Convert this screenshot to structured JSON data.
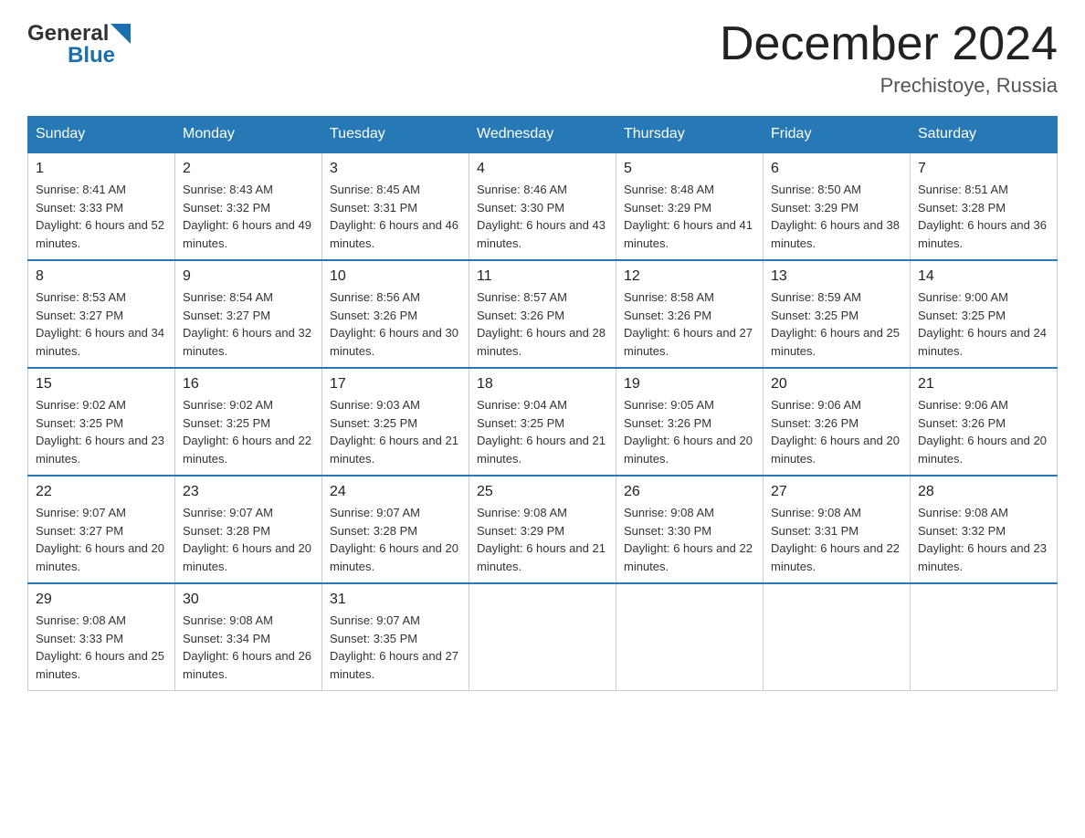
{
  "header": {
    "logo_general": "General",
    "logo_blue": "Blue",
    "month_title": "December 2024",
    "location": "Prechistoye, Russia"
  },
  "days_of_week": [
    "Sunday",
    "Monday",
    "Tuesday",
    "Wednesday",
    "Thursday",
    "Friday",
    "Saturday"
  ],
  "weeks": [
    [
      {
        "day": "1",
        "sunrise": "8:41 AM",
        "sunset": "3:33 PM",
        "daylight": "6 hours and 52 minutes."
      },
      {
        "day": "2",
        "sunrise": "8:43 AM",
        "sunset": "3:32 PM",
        "daylight": "6 hours and 49 minutes."
      },
      {
        "day": "3",
        "sunrise": "8:45 AM",
        "sunset": "3:31 PM",
        "daylight": "6 hours and 46 minutes."
      },
      {
        "day": "4",
        "sunrise": "8:46 AM",
        "sunset": "3:30 PM",
        "daylight": "6 hours and 43 minutes."
      },
      {
        "day": "5",
        "sunrise": "8:48 AM",
        "sunset": "3:29 PM",
        "daylight": "6 hours and 41 minutes."
      },
      {
        "day": "6",
        "sunrise": "8:50 AM",
        "sunset": "3:29 PM",
        "daylight": "6 hours and 38 minutes."
      },
      {
        "day": "7",
        "sunrise": "8:51 AM",
        "sunset": "3:28 PM",
        "daylight": "6 hours and 36 minutes."
      }
    ],
    [
      {
        "day": "8",
        "sunrise": "8:53 AM",
        "sunset": "3:27 PM",
        "daylight": "6 hours and 34 minutes."
      },
      {
        "day": "9",
        "sunrise": "8:54 AM",
        "sunset": "3:27 PM",
        "daylight": "6 hours and 32 minutes."
      },
      {
        "day": "10",
        "sunrise": "8:56 AM",
        "sunset": "3:26 PM",
        "daylight": "6 hours and 30 minutes."
      },
      {
        "day": "11",
        "sunrise": "8:57 AM",
        "sunset": "3:26 PM",
        "daylight": "6 hours and 28 minutes."
      },
      {
        "day": "12",
        "sunrise": "8:58 AM",
        "sunset": "3:26 PM",
        "daylight": "6 hours and 27 minutes."
      },
      {
        "day": "13",
        "sunrise": "8:59 AM",
        "sunset": "3:25 PM",
        "daylight": "6 hours and 25 minutes."
      },
      {
        "day": "14",
        "sunrise": "9:00 AM",
        "sunset": "3:25 PM",
        "daylight": "6 hours and 24 minutes."
      }
    ],
    [
      {
        "day": "15",
        "sunrise": "9:02 AM",
        "sunset": "3:25 PM",
        "daylight": "6 hours and 23 minutes."
      },
      {
        "day": "16",
        "sunrise": "9:02 AM",
        "sunset": "3:25 PM",
        "daylight": "6 hours and 22 minutes."
      },
      {
        "day": "17",
        "sunrise": "9:03 AM",
        "sunset": "3:25 PM",
        "daylight": "6 hours and 21 minutes."
      },
      {
        "day": "18",
        "sunrise": "9:04 AM",
        "sunset": "3:25 PM",
        "daylight": "6 hours and 21 minutes."
      },
      {
        "day": "19",
        "sunrise": "9:05 AM",
        "sunset": "3:26 PM",
        "daylight": "6 hours and 20 minutes."
      },
      {
        "day": "20",
        "sunrise": "9:06 AM",
        "sunset": "3:26 PM",
        "daylight": "6 hours and 20 minutes."
      },
      {
        "day": "21",
        "sunrise": "9:06 AM",
        "sunset": "3:26 PM",
        "daylight": "6 hours and 20 minutes."
      }
    ],
    [
      {
        "day": "22",
        "sunrise": "9:07 AM",
        "sunset": "3:27 PM",
        "daylight": "6 hours and 20 minutes."
      },
      {
        "day": "23",
        "sunrise": "9:07 AM",
        "sunset": "3:28 PM",
        "daylight": "6 hours and 20 minutes."
      },
      {
        "day": "24",
        "sunrise": "9:07 AM",
        "sunset": "3:28 PM",
        "daylight": "6 hours and 20 minutes."
      },
      {
        "day": "25",
        "sunrise": "9:08 AM",
        "sunset": "3:29 PM",
        "daylight": "6 hours and 21 minutes."
      },
      {
        "day": "26",
        "sunrise": "9:08 AM",
        "sunset": "3:30 PM",
        "daylight": "6 hours and 22 minutes."
      },
      {
        "day": "27",
        "sunrise": "9:08 AM",
        "sunset": "3:31 PM",
        "daylight": "6 hours and 22 minutes."
      },
      {
        "day": "28",
        "sunrise": "9:08 AM",
        "sunset": "3:32 PM",
        "daylight": "6 hours and 23 minutes."
      }
    ],
    [
      {
        "day": "29",
        "sunrise": "9:08 AM",
        "sunset": "3:33 PM",
        "daylight": "6 hours and 25 minutes."
      },
      {
        "day": "30",
        "sunrise": "9:08 AM",
        "sunset": "3:34 PM",
        "daylight": "6 hours and 26 minutes."
      },
      {
        "day": "31",
        "sunrise": "9:07 AM",
        "sunset": "3:35 PM",
        "daylight": "6 hours and 27 minutes."
      },
      null,
      null,
      null,
      null
    ]
  ]
}
